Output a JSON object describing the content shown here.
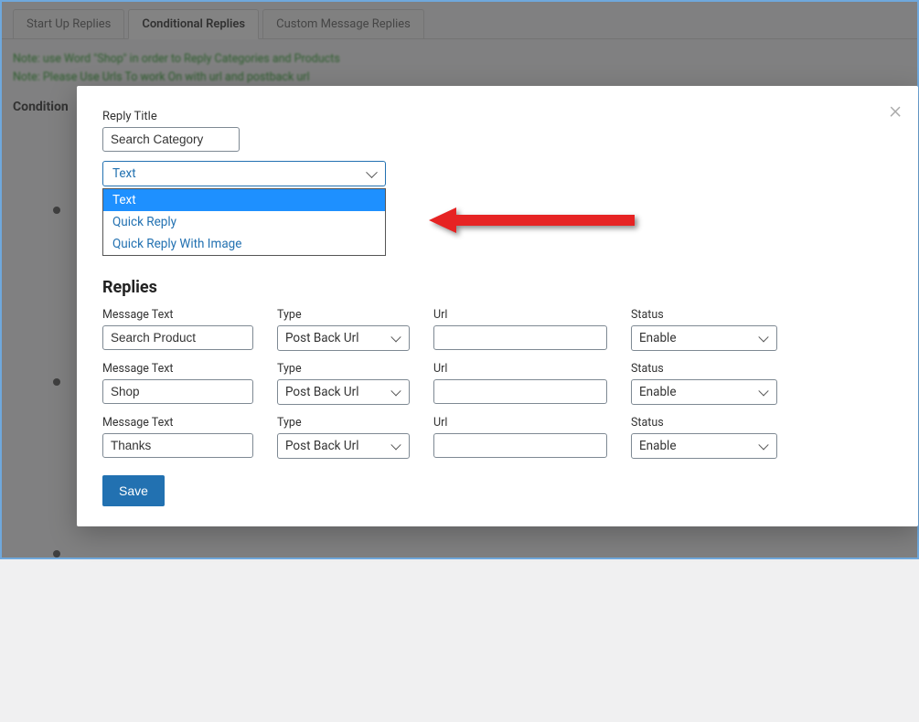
{
  "tabs": {
    "items": [
      {
        "label": "Start Up Replies"
      },
      {
        "label": "Conditional Replies"
      },
      {
        "label": "Custom Message Replies"
      }
    ],
    "activeIndex": 1
  },
  "hints": {
    "line1": "Note: use Word \"Shop\" in order to Reply Categories and Products",
    "line2": "Note: Please Use Urls To work On with url and postback url"
  },
  "sectionLabel": "Condition",
  "modal": {
    "closeGlyph": "×",
    "replyTitle": {
      "label": "Reply Title",
      "value": "Search Category"
    },
    "typeSelect": {
      "selected": "Text",
      "options": [
        "Text",
        "Quick Reply",
        "Quick Reply With Image"
      ]
    },
    "repliesHeading": "Replies",
    "columns": {
      "messageText": "Message Text",
      "type": "Type",
      "url": "Url",
      "status": "Status"
    },
    "rows": [
      {
        "messageText": "Search Product",
        "type": "Post Back Url",
        "url": "",
        "status": "Enable"
      },
      {
        "messageText": "Shop",
        "type": "Post Back Url",
        "url": "",
        "status": "Enable"
      },
      {
        "messageText": "Thanks",
        "type": "Post Back Url",
        "url": "",
        "status": "Enable"
      }
    ],
    "saveLabel": "Save"
  },
  "icons": {
    "chevronDown": "chevron-down-icon",
    "close": "close-icon"
  },
  "colors": {
    "accent": "#2271b1",
    "highlight": "#1e90ff",
    "overlay": "rgba(60,60,60,0.62)",
    "arrow": "#e62323"
  }
}
